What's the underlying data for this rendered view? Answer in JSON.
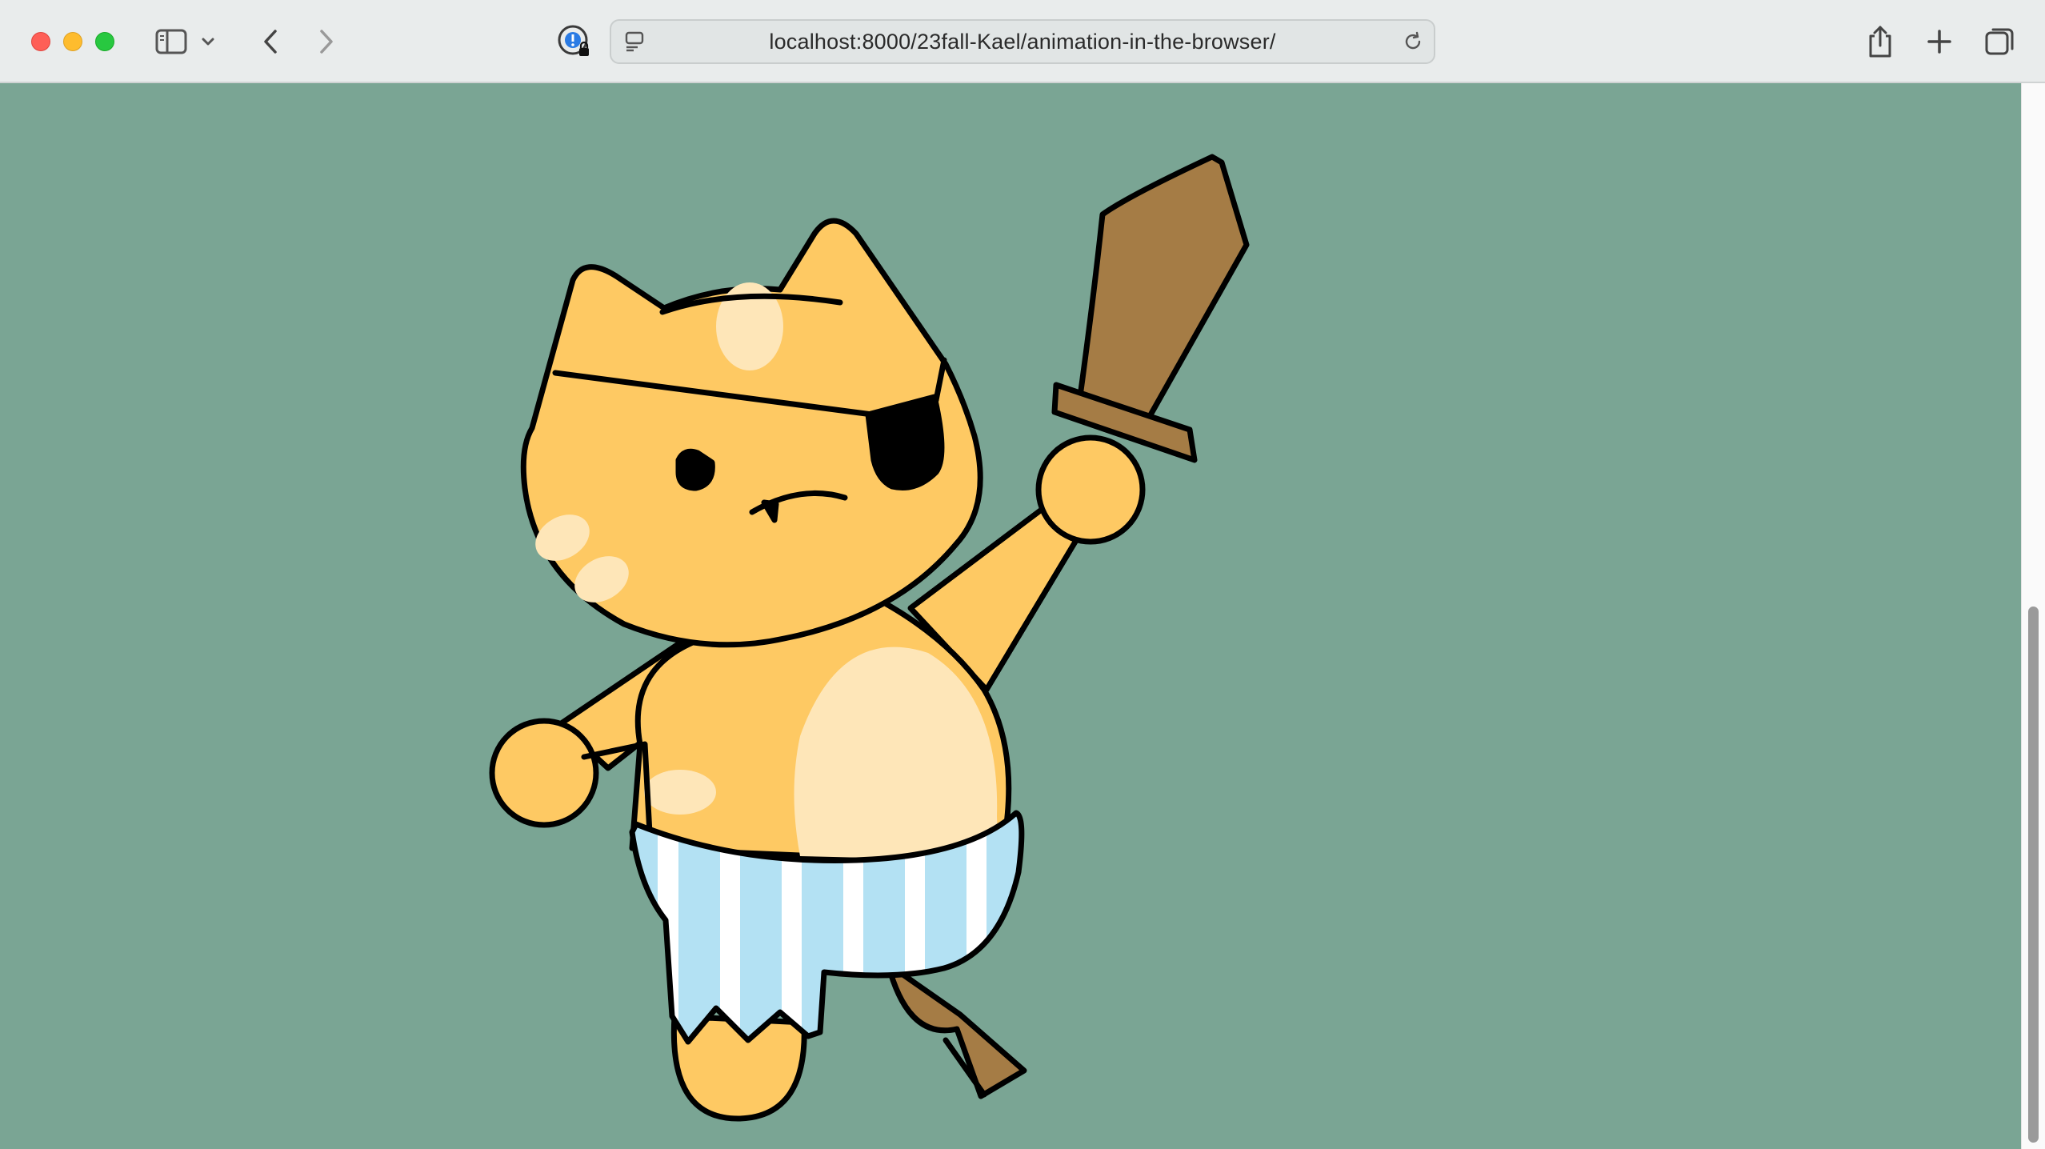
{
  "browser": {
    "url": "localhost:8000/23fall-Kael/animation-in-the-browser/",
    "icons": {
      "close": "close-window-button",
      "minimize": "minimize-window-button",
      "maximize": "maximize-window-button",
      "sidebar": "sidebar-icon",
      "sidebar_menu": "chevron-down-icon",
      "back": "chevron-left-icon",
      "forward": "chevron-right-icon",
      "privacy": "privacy-report-icon",
      "page_menu": "page-menu-icon",
      "reload": "reload-icon",
      "share": "share-icon",
      "new_tab": "plus-icon",
      "tab_overview": "tab-overview-icon"
    }
  },
  "page": {
    "background_color": "#7aa594",
    "character": "pirate-cat",
    "colors": {
      "fur": "#fec963",
      "fur_light": "#fee6b8",
      "outline": "#000000",
      "wood": "#a57c45",
      "stripe_blue": "#b3e1f3",
      "stripe_white": "#ffffff"
    }
  }
}
